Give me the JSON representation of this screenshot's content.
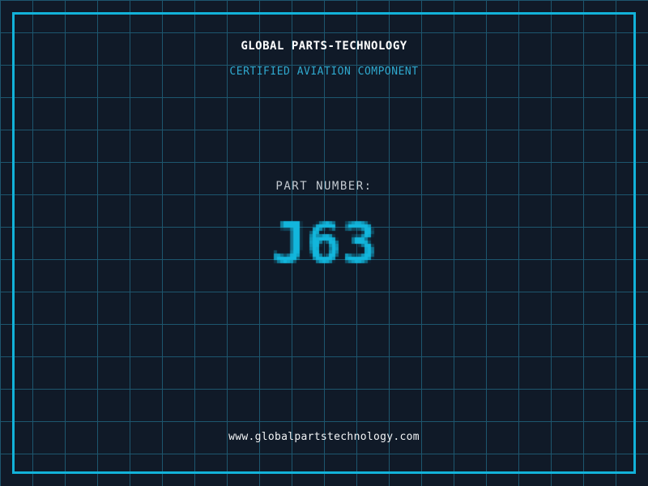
{
  "header": {
    "title": "GLOBAL PARTS-TECHNOLOGY",
    "subtitle": "CERTIFIED AVIATION COMPONENT"
  },
  "part_number": {
    "label": "PART NUMBER:",
    "value": "J63"
  },
  "footer": {
    "url": "www.globalpartstechnology.com"
  },
  "colors": {
    "background": "#101a28",
    "grid_line": "#1d566e",
    "frame_border": "#12b2d9",
    "title_text": "#ffffff",
    "subtitle_text": "#2fa9cf",
    "part_label_text": "#c3cad1",
    "part_number_value": "#12b6dc",
    "url_text": "#f2f4f6"
  }
}
